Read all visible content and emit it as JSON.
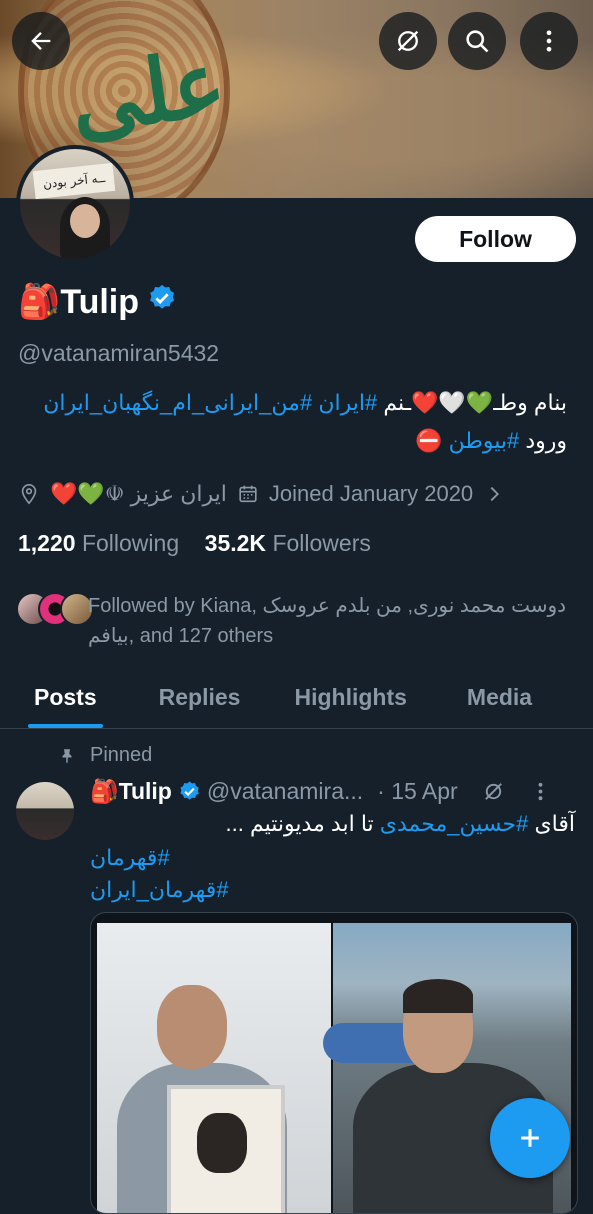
{
  "header": {
    "back_icon": "back-arrow-icon",
    "grok_icon": "grok-slash-circle-icon",
    "search_icon": "search-icon",
    "more_icon": "more-vertical-icon"
  },
  "profile": {
    "name": "🎒Tulip",
    "handle": "@vatanamiran5432",
    "follow_label": "Follow",
    "bio": {
      "line1_text": "بنام وطـ💚🤍❤️ـنم ",
      "line1_tag1": "#ایران",
      "line1_tag2": "#من_ایرانی_ام_نگهبان_ایران",
      "line2_text": "ورود ",
      "line2_tag": "#بیوطن",
      "line2_emoji": "⛔"
    },
    "location": "ایران عزیز ☫💚❤️",
    "joined": "Joined January 2020",
    "following_count": "1,220",
    "following_label": "Following",
    "followers_count": "35.2K",
    "followers_label": "Followers",
    "followed_by": "Followed by Kiana, دوست محمد نوری, من بلدم عروسک بیافم, and 127 others"
  },
  "tabs": [
    "Posts",
    "Replies",
    "Highlights",
    "Media"
  ],
  "post": {
    "pinned_label": "Pinned",
    "author": "🎒Tulip",
    "handle": "@vatanamira...",
    "date": "· 15 Apr",
    "text_prefix": "آقای ",
    "text_tag": "#حسین_محمدی",
    "text_suffix": " تا ابد مدیونتیم ...",
    "tag1": "#قهرمان",
    "tag2": "#قهرمان_ایران"
  },
  "colors": {
    "background": "#15202b",
    "accent": "#1d9bf0",
    "muted": "#8b98a5",
    "white": "#ffffff"
  }
}
